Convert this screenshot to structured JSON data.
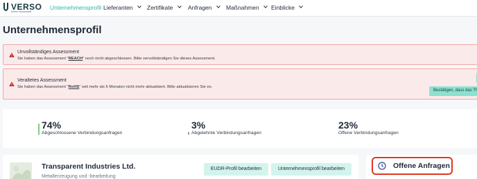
{
  "brand": {
    "name": "VERSO",
    "tagline": "former sustainabill"
  },
  "nav": {
    "items": [
      {
        "label": "Unternehmensprofil",
        "active": true,
        "has_dropdown": false
      },
      {
        "label": "Lieferanten",
        "active": false,
        "has_dropdown": true
      },
      {
        "label": "Zertifikate",
        "active": false,
        "has_dropdown": true
      },
      {
        "label": "Anfragen",
        "active": false,
        "has_dropdown": true
      },
      {
        "label": "Maßnahmen",
        "active": false,
        "has_dropdown": true
      },
      {
        "label": "Einblicke",
        "active": false,
        "has_dropdown": true
      }
    ]
  },
  "page": {
    "title": "Unternehmensprofil"
  },
  "alerts": [
    {
      "title": "Unvollständiges Assessment",
      "text_before": "Sie haben das Assessment \"",
      "assessment": "REACH",
      "text_after": "\" noch nicht abgeschlossen. Bitte vervollständigen Sie dieses Assessment."
    },
    {
      "title": "Veraltetes Assessment",
      "text_before": "Sie haben das Assessment \"",
      "assessment": "RoHS",
      "text_after": "\" seit mehr als 6 Monaten nicht mehr aktualisiert. Bitte aktualisieren Sie es.",
      "button_label": "Bestätigen, dass das Th"
    }
  ],
  "stats": [
    {
      "value": "74%",
      "label": "Abgeschlossene Verbindungsanfragen",
      "accent": "#7ed07a"
    },
    {
      "value": "3%",
      "label": "Abgelehnte Verbindungsanfragen",
      "accent": "#9aa4ad"
    },
    {
      "value": "23%",
      "label": "Offene Verbindungsanfragen",
      "accent": ""
    }
  ],
  "company": {
    "name": "Transparent Industries Ltd.",
    "industry": "Metallerzeugung und -bearbeitung",
    "buttons": {
      "eudr": "EUDR-Profil bearbeiten",
      "profile": "Unternehmensprofil bearbeiten"
    }
  },
  "open_requests": {
    "label": "Offene Anfragen"
  },
  "colors": {
    "accent": "#2cb59d",
    "alert_bg": "#fbeaea",
    "alert_border": "#f2a6a6",
    "button_bg": "#d3f4ed",
    "highlight": "#e0361f"
  },
  "icons": [
    "verso-logo-icon",
    "chevron-down-icon",
    "warning-icon",
    "clock-icon"
  ]
}
